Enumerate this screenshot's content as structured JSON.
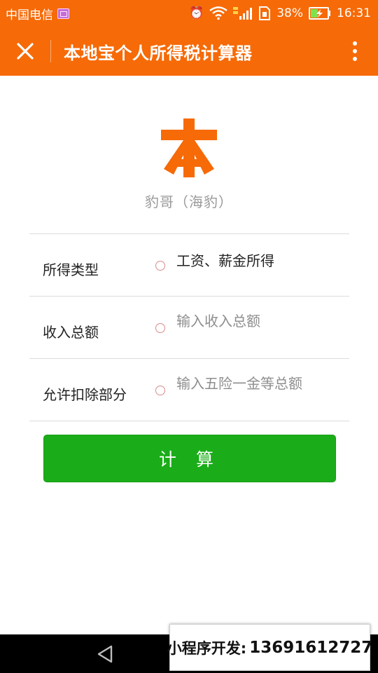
{
  "status_bar": {
    "carrier": "中国电信",
    "battery": "38%",
    "time": "16:31"
  },
  "app_bar": {
    "title": "本地宝个人所得税计算器"
  },
  "logo": {
    "glyph": "本",
    "author": "豹哥（海豹）"
  },
  "form": {
    "rows": [
      {
        "label": "所得类型",
        "value": "工资、薪金所得"
      },
      {
        "label": "收入总额",
        "placeholder": "输入收入总额"
      },
      {
        "label": "允许扣除部分",
        "placeholder": "输入五险一金等总额"
      }
    ]
  },
  "calculate_button": {
    "label": "计 算"
  },
  "promo": {
    "label": "小程序开发:",
    "phone": "13691612727"
  },
  "colors": {
    "brand_orange": "#f66a07",
    "button_green": "#1aad19"
  }
}
